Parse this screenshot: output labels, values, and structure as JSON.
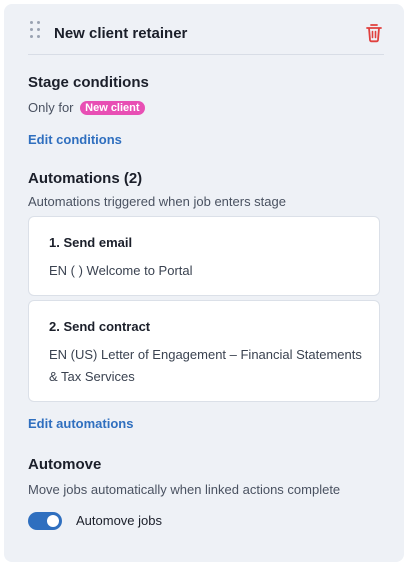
{
  "header": {
    "title": "New client retainer",
    "drag_icon": "drag-handle-icon",
    "delete_icon": "trash-icon",
    "delete_color": "#e0403e"
  },
  "stage_conditions": {
    "heading": "Stage conditions",
    "only_for_text": "Only for",
    "badge_label": "New client",
    "badge_color": "#e84fb4",
    "edit_link": "Edit conditions"
  },
  "automations": {
    "heading": "Automations (2)",
    "description": "Automations triggered when job enters stage",
    "items": [
      {
        "title": "1. Send email",
        "detail": "EN ( ) Welcome to Portal"
      },
      {
        "title": "2. Send contract",
        "detail": "EN (US) Letter of Engagement – Financial Statements & Tax Services"
      }
    ],
    "edit_link": "Edit automations"
  },
  "automove": {
    "heading": "Automove",
    "description": "Move jobs automatically when linked actions complete",
    "toggle_label": "Automove jobs",
    "toggle_on": true,
    "accent_color": "#2f6fbf"
  }
}
